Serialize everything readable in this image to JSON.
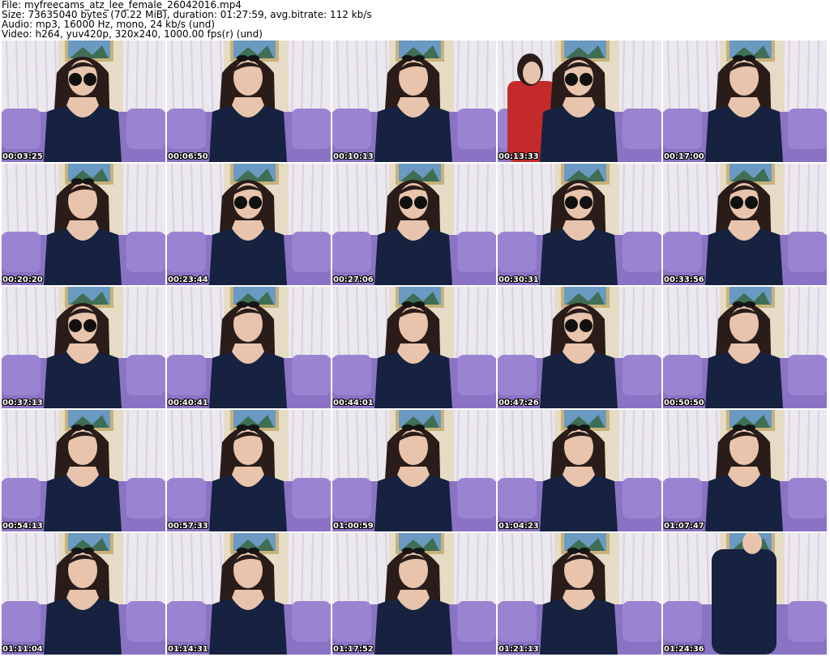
{
  "header": {
    "file": "File: myfreecams_atz_lee_female_26042016.mp4",
    "size": "Size: 73635040 bytes (70.22 MiB), duration: 01:27:59, avg.bitrate: 112 kb/s",
    "audio": "Audio: mp3, 16000 Hz, mono, 24 kb/s (und)",
    "video": "Video: h264, yuv420p, 320x240, 1000.00 fps(r) (und)"
  },
  "colors": {
    "sofa": "#8a73c4",
    "curtain": "#ece8ef",
    "wall": "#e6dcc5",
    "painting": "#6a9ac2",
    "frame": "#c7b27a",
    "dress": "#16223f",
    "hair": "#2a1c18",
    "skin": "#e8c4ac",
    "red_top": "#c42a2a"
  },
  "thumbnails": [
    {
      "time": "00:03:25",
      "glasses": true,
      "shift": 0
    },
    {
      "time": "00:06:50",
      "glasses": false,
      "shift": 0
    },
    {
      "time": "00:10:13",
      "glasses": false,
      "shift": 0
    },
    {
      "time": "00:13:33",
      "glasses": true,
      "shift": 0,
      "second_person": true
    },
    {
      "time": "00:17:00",
      "glasses": false,
      "shift": 0
    },
    {
      "time": "00:20:20",
      "glasses": false,
      "shift": 0
    },
    {
      "time": "00:23:44",
      "glasses": true,
      "shift": 0
    },
    {
      "time": "00:27:06",
      "glasses": true,
      "shift": 0
    },
    {
      "time": "00:30:31",
      "glasses": true,
      "shift": 0
    },
    {
      "time": "00:33:56",
      "glasses": true,
      "shift": 0
    },
    {
      "time": "00:37:13",
      "glasses": true,
      "shift": 0
    },
    {
      "time": "00:40:41",
      "glasses": false,
      "shift": 0
    },
    {
      "time": "00:44:01",
      "glasses": false,
      "shift": 0
    },
    {
      "time": "00:47:26",
      "glasses": true,
      "shift": 0
    },
    {
      "time": "00:50:50",
      "glasses": false,
      "shift": 0
    },
    {
      "time": "00:54:13",
      "glasses": false,
      "shift": 0
    },
    {
      "time": "00:57:33",
      "glasses": false,
      "shift": 0
    },
    {
      "time": "01:00:59",
      "glasses": false,
      "shift": 0
    },
    {
      "time": "01:04:23",
      "glasses": false,
      "shift": 0
    },
    {
      "time": "01:07:47",
      "glasses": false,
      "shift": 0
    },
    {
      "time": "01:11:04",
      "glasses": false,
      "shift": 0
    },
    {
      "time": "01:14:31",
      "glasses": false,
      "shift": 0
    },
    {
      "time": "01:17:52",
      "glasses": false,
      "shift": 0
    },
    {
      "time": "01:21:13",
      "glasses": false,
      "shift": 0
    },
    {
      "time": "01:24:36",
      "glasses": false,
      "shift": 0,
      "standing": true
    }
  ]
}
